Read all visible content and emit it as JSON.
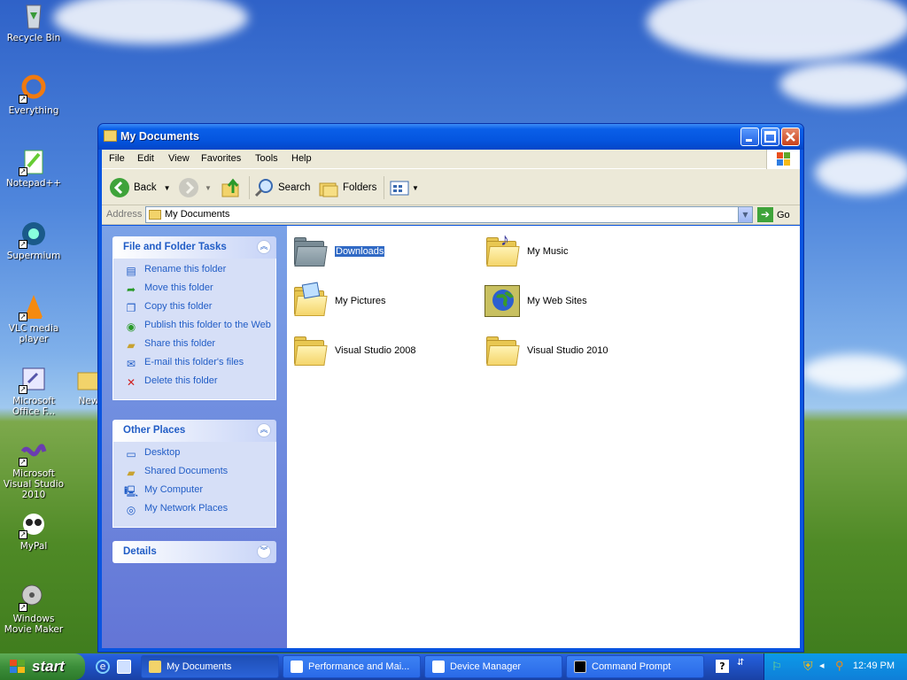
{
  "desktop": {
    "icons": [
      {
        "label": "Recycle Bin",
        "icon": "recycle-bin-icon"
      },
      {
        "label": "Everything",
        "icon": "everything-icon"
      },
      {
        "label": "Notepad++",
        "icon": "notepad-plus-plus-icon"
      },
      {
        "label": "Supermium",
        "icon": "supermium-icon"
      },
      {
        "label": "VLC media player",
        "icon": "vlc-icon"
      },
      {
        "label": "Microsoft Office F...",
        "icon": "office-icon"
      },
      {
        "label": "Microsoft Visual Studio 2010",
        "icon": "visual-studio-icon"
      },
      {
        "label": "MyPal",
        "icon": "mypal-icon"
      },
      {
        "label": "Windows Movie Maker",
        "icon": "movie-maker-icon"
      },
      {
        "label": "New",
        "icon": "folder-icon"
      }
    ]
  },
  "window": {
    "title": "My Documents",
    "menu": [
      "File",
      "Edit",
      "View",
      "Favorites",
      "Tools",
      "Help"
    ],
    "toolbar": {
      "back": "Back",
      "search": "Search",
      "folders": "Folders"
    },
    "address": {
      "label": "Address",
      "value": "My Documents",
      "go": "Go"
    },
    "taskpane": {
      "file_tasks": {
        "title": "File and Folder Tasks",
        "items": [
          "Rename this folder",
          "Move this folder",
          "Copy this folder",
          "Publish this folder to the Web",
          "Share this folder",
          "E-mail this folder's files",
          "Delete this folder"
        ]
      },
      "other_places": {
        "title": "Other Places",
        "items": [
          "Desktop",
          "Shared Documents",
          "My Computer",
          "My Network Places"
        ]
      },
      "details": {
        "title": "Details"
      }
    },
    "files": [
      "Downloads",
      "My Music",
      "My Pictures",
      "My Web Sites",
      "Visual Studio 2008",
      "Visual Studio 2010"
    ],
    "selected_file": "Downloads"
  },
  "taskbar": {
    "start": "start",
    "tasks": [
      "My Documents",
      "Performance and Mai...",
      "Device Manager",
      "Command Prompt"
    ],
    "active_task": "My Documents",
    "clock": "12:49 PM"
  },
  "colors": {
    "titlebar": "#0556e0",
    "taskpane_link": "#215dc6",
    "selection": "#316ac5",
    "start": "#3c8e3a"
  }
}
